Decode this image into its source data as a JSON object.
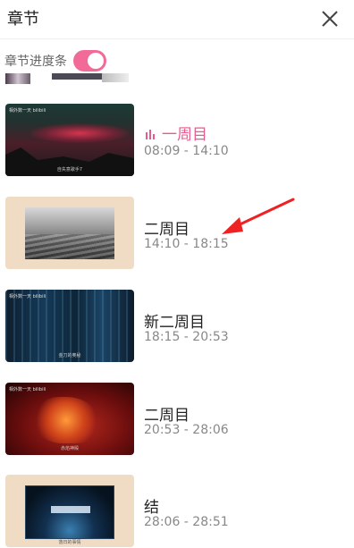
{
  "header": {
    "title": "章节"
  },
  "progress": {
    "label": "章节进度条",
    "enabled": true
  },
  "colors": {
    "accent": "#e75b8f",
    "toggle": "#f26a97",
    "annotation_arrow": "#ee2222"
  },
  "chapters": [
    {
      "title": "一周目",
      "time": "08:09 - 14:10",
      "active": true,
      "thumb_caption": "自失意歌手7"
    },
    {
      "title": "二周目",
      "time": "14:10 - 18:15",
      "active": false
    },
    {
      "title": "新二周目",
      "time": "18:15 - 20:53",
      "active": false,
      "thumb_caption": "金刀的奥秘"
    },
    {
      "title": "二周目",
      "time": "20:53 - 28:06",
      "active": false,
      "thumb_caption": "赤焰神殿"
    },
    {
      "title": "结",
      "time": "28:06 - 28:51",
      "active": false,
      "thumb_caption": "落日的事情"
    }
  ],
  "thumbnail_brand": "相外数一天 bilibili",
  "icons": {
    "close": "close-icon",
    "playing": "playing-bars-icon"
  }
}
